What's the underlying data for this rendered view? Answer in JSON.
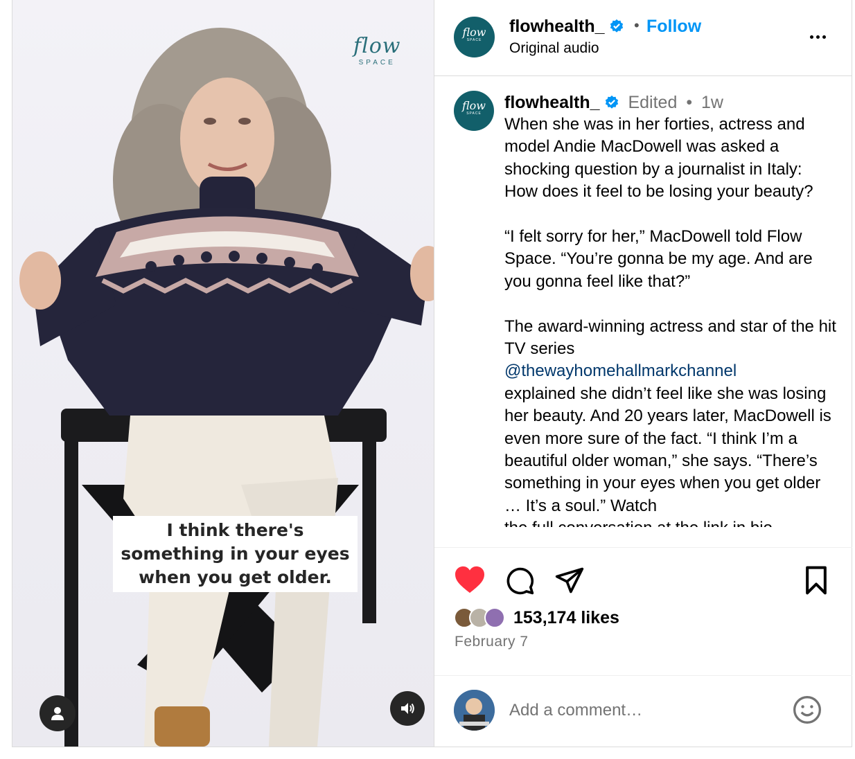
{
  "media": {
    "brand_logo_text": "flow",
    "brand_logo_sub": "SPACE",
    "caption_lines": [
      "I think there's",
      "something in your eyes",
      "when you get older."
    ]
  },
  "header": {
    "username": "flowhealth_",
    "dot": "•",
    "follow_label": "Follow",
    "audio_label": "Original audio",
    "avatar_text": "flow",
    "avatar_sub": "SPACE"
  },
  "caption": {
    "username": "flowhealth_",
    "edited": "Edited",
    "dot": "•",
    "time": "1w",
    "paragraphs": [
      "When she was in her forties, actress and model Andie MacDowell was asked a shocking question by a journalist in Italy: How does it feel to be losing your beauty?",
      "“I felt sorry for her,” MacDowell told Flow Space. “You’re gonna be my age. And are you gonna feel like that?”"
    ],
    "p3_before": "The award-winning actress and star of the hit TV series",
    "mention": "@thewayhomehallmarkchannel",
    "p3_after": "explained she didn’t feel like she was losing her beauty. And 20 years later, MacDowell is even more sure of the fact. “I think I’m a beautiful older woman,” she says. “There’s something in your eyes when you get older … It’s a soul.” Watch",
    "p3_cut": "the full conversation at the link in bio."
  },
  "actions": {
    "likes": "153,174 likes",
    "date": "February 7",
    "like_state": "liked",
    "colors": {
      "like": "#ff3040",
      "link": "#0095f6",
      "mention": "#00376b"
    }
  },
  "comment": {
    "placeholder": "Add a comment…"
  },
  "icons": {
    "like": "heart-icon",
    "comment": "comment-icon",
    "share": "share-icon",
    "save": "bookmark-icon",
    "emoji": "emoji-icon",
    "more": "more-icon",
    "user": "user-icon",
    "audio": "audio-icon",
    "verified": "verified-badge-icon"
  }
}
